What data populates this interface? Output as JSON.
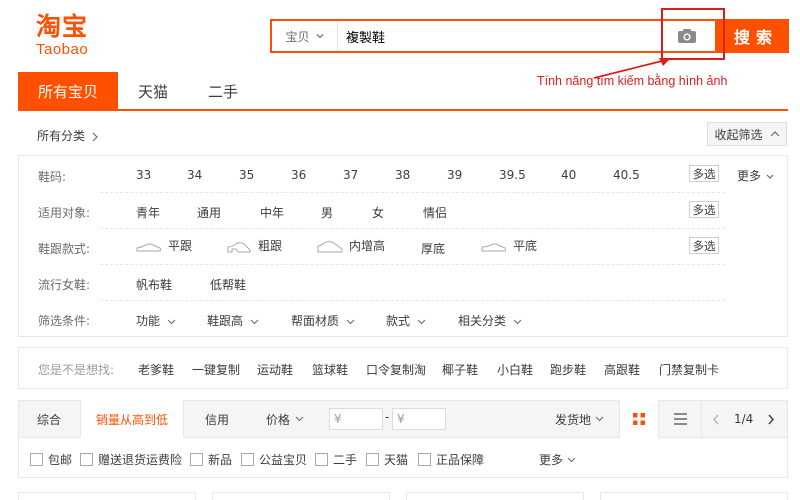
{
  "logo": {
    "cn": "淘宝",
    "en": "Taobao"
  },
  "search": {
    "scope": "宝贝",
    "query": "複製鞋",
    "button": "搜索"
  },
  "annotation": "Tính năng tìm kiếm bằng hình ảnh",
  "tabs": [
    {
      "label": "所有宝贝"
    },
    {
      "label": "天猫"
    },
    {
      "label": "二手"
    }
  ],
  "breadcrumb": "所有分类",
  "collapse_label": "收起筛选",
  "filters": {
    "size": {
      "label": "鞋码:",
      "values": [
        "33",
        "34",
        "35",
        "36",
        "37",
        "38",
        "39",
        "39.5",
        "40",
        "40.5"
      ],
      "multi": "多选",
      "more": "更多"
    },
    "audience": {
      "label": "适用对象:",
      "values": [
        "青年",
        "通用",
        "中年",
        "男",
        "女",
        "情侣"
      ],
      "multi": "多选"
    },
    "heel": {
      "label": "鞋跟款式:",
      "values": [
        "平跟",
        "粗跟",
        "内增高",
        "厚底",
        "平底"
      ],
      "multi": "多选"
    },
    "trend": {
      "label": "流行女鞋:",
      "values": [
        "帆布鞋",
        "低帮鞋"
      ]
    },
    "conditions": {
      "label": "筛选条件:",
      "values": [
        "功能",
        "鞋跟高",
        "帮面材质",
        "款式",
        "相关分类"
      ]
    }
  },
  "suggestions": {
    "label": "您是不是想找:",
    "items": [
      "老爹鞋",
      "一键复制",
      "运动鞋",
      "篮球鞋",
      "口令复制淘",
      "椰子鞋",
      "小白鞋",
      "跑步鞋",
      "高跟鞋",
      "门禁复制卡"
    ]
  },
  "sort": {
    "items": [
      "综合",
      "销量从高到低",
      "信用",
      "价格"
    ],
    "price_from": "¥",
    "price_to": "¥",
    "price_dash": "-",
    "ship_from": "发货地",
    "page": "1/4"
  },
  "checkboxes": [
    "包邮",
    "赠送退货运费险",
    "新品",
    "公益宝贝",
    "二手",
    "天猫",
    "正品保障"
  ],
  "checkbox_more": "更多",
  "colors": {
    "accent": "#ff5000",
    "annotation": "#e01b1b"
  }
}
